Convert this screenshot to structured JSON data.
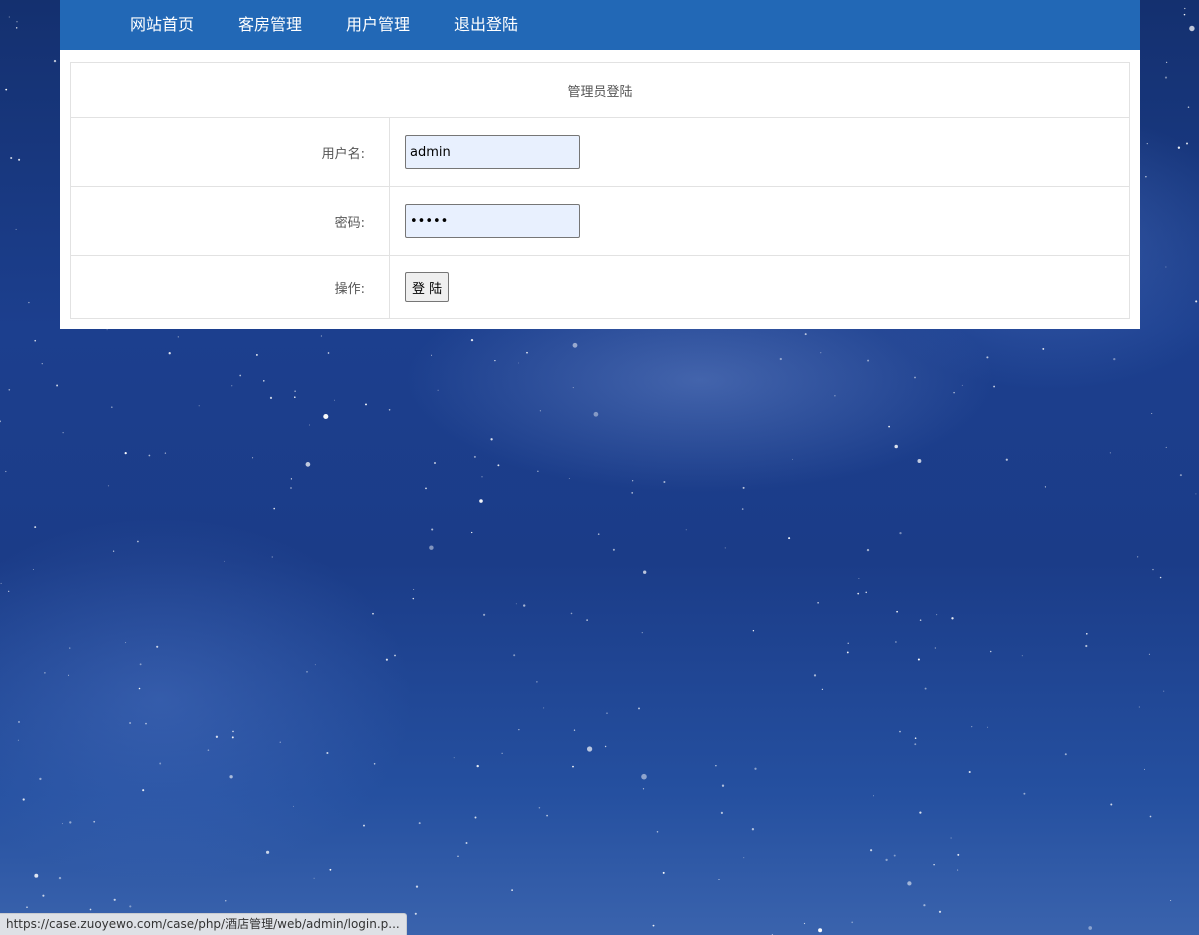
{
  "nav": {
    "items": [
      {
        "label": "网站首页"
      },
      {
        "label": "客房管理"
      },
      {
        "label": "用户管理"
      },
      {
        "label": "退出登陆"
      }
    ]
  },
  "login_form": {
    "title": "管理员登陆",
    "username_label": "用户名:",
    "username_value": "admin",
    "password_label": "密码:",
    "password_value": "•••••",
    "action_label": "操作:",
    "submit_label": "登 陆"
  },
  "status_bar": {
    "url": "https://case.zuoyewo.com/case/php/酒店管理/web/admin/login.p..."
  },
  "colors": {
    "nav_background": "#2268b6",
    "input_background": "#e8f0fe",
    "page_background": "#1c3f8e"
  }
}
